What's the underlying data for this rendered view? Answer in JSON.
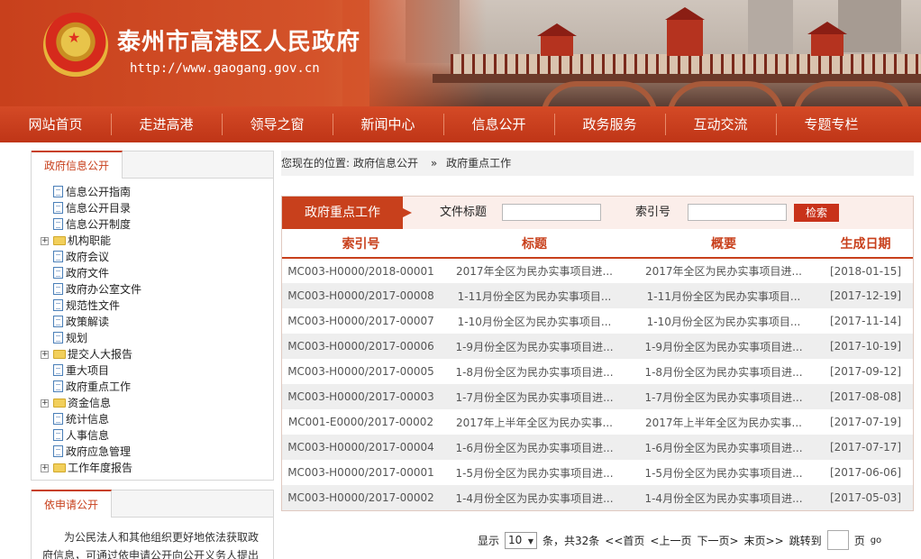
{
  "header": {
    "site_title": "泰州市高港区人民政府",
    "site_url": "http://www.gaogang.gov.cn"
  },
  "nav": {
    "items": [
      "网站首页",
      "走进高港",
      "领导之窗",
      "新闻中心",
      "信息公开",
      "政务服务",
      "互动交流",
      "专题专栏"
    ]
  },
  "sidebar": {
    "tab": "政府信息公开",
    "items": [
      {
        "label": "信息公开指南",
        "kind": "doc"
      },
      {
        "label": "信息公开目录",
        "kind": "doc"
      },
      {
        "label": "信息公开制度",
        "kind": "doc"
      },
      {
        "label": "机构职能",
        "kind": "folder"
      },
      {
        "label": "政府会议",
        "kind": "doc"
      },
      {
        "label": "政府文件",
        "kind": "doc"
      },
      {
        "label": "政府办公室文件",
        "kind": "doc"
      },
      {
        "label": "规范性文件",
        "kind": "doc"
      },
      {
        "label": "政策解读",
        "kind": "doc"
      },
      {
        "label": "规划",
        "kind": "doc"
      },
      {
        "label": "提交人大报告",
        "kind": "folder"
      },
      {
        "label": "重大项目",
        "kind": "doc"
      },
      {
        "label": "政府重点工作",
        "kind": "doc"
      },
      {
        "label": "资金信息",
        "kind": "folder"
      },
      {
        "label": "统计信息",
        "kind": "doc"
      },
      {
        "label": "人事信息",
        "kind": "doc"
      },
      {
        "label": "政府应急管理",
        "kind": "doc"
      },
      {
        "label": "工作年度报告",
        "kind": "folder"
      }
    ]
  },
  "apply_panel": {
    "tab": "依申请公开",
    "text": "为公民法人和其他组织更好地依法获取政府信息，可通过依申请公开向公开义务人提出"
  },
  "breadcrumb": {
    "prefix": "您现在的位置:",
    "items": [
      "政府信息公开",
      "政府重点工作"
    ],
    "separator": "»"
  },
  "filter": {
    "section_tab": "政府重点工作",
    "title_label": "文件标题",
    "title_value": "",
    "index_label": "索引号",
    "index_value": "",
    "search_button": "检索"
  },
  "table": {
    "headers": [
      "索引号",
      "标题",
      "概要",
      "生成日期"
    ],
    "rows": [
      {
        "index": "MC003-H0000/2018-00001",
        "title": "2017年全区为民办实事项目进...",
        "summary": "2017年全区为民办实事项目进...",
        "date": "[2018-01-15]"
      },
      {
        "index": "MC003-H0000/2017-00008",
        "title": "1-11月份全区为民办实事项目...",
        "summary": "1-11月份全区为民办实事项目...",
        "date": "[2017-12-19]"
      },
      {
        "index": "MC003-H0000/2017-00007",
        "title": "1-10月份全区为民办实事项目...",
        "summary": "1-10月份全区为民办实事项目...",
        "date": "[2017-11-14]"
      },
      {
        "index": "MC003-H0000/2017-00006",
        "title": "1-9月份全区为民办实事项目进...",
        "summary": "1-9月份全区为民办实事项目进...",
        "date": "[2017-10-19]"
      },
      {
        "index": "MC003-H0000/2017-00005",
        "title": "1-8月份全区为民办实事项目进...",
        "summary": "1-8月份全区为民办实事项目进...",
        "date": "[2017-09-12]"
      },
      {
        "index": "MC003-H0000/2017-00003",
        "title": "1-7月份全区为民办实事项目进...",
        "summary": "1-7月份全区为民办实事项目进...",
        "date": "[2017-08-08]"
      },
      {
        "index": "MC001-E0000/2017-00002",
        "title": "2017年上半年全区为民办实事...",
        "summary": "2017年上半年全区为民办实事...",
        "date": "[2017-07-19]"
      },
      {
        "index": "MC003-H0000/2017-00004",
        "title": "1-6月份全区为民办实事项目进...",
        "summary": "1-6月份全区为民办实事项目进...",
        "date": "[2017-07-17]"
      },
      {
        "index": "MC003-H0000/2017-00001",
        "title": "1-5月份全区为民办实事项目进...",
        "summary": "1-5月份全区为民办实事项目进...",
        "date": "[2017-06-06]"
      },
      {
        "index": "MC003-H0000/2017-00002",
        "title": "1-4月份全区为民办实事项目进...",
        "summary": "1-4月份全区为民办实事项目进...",
        "date": "[2017-05-03]"
      }
    ]
  },
  "pager": {
    "show_label": "显示",
    "per_page": "10",
    "count_label": "条，共32条",
    "first": "<<首页",
    "prev": "<上一页",
    "next": "下一页>",
    "last": "末页>>",
    "goto_label": "跳转到",
    "page_unit": "页",
    "go": "go"
  },
  "colors": {
    "brand_red": "#c8401c",
    "nav_red": "#bf3517",
    "row_alt": "#eeeeee"
  }
}
